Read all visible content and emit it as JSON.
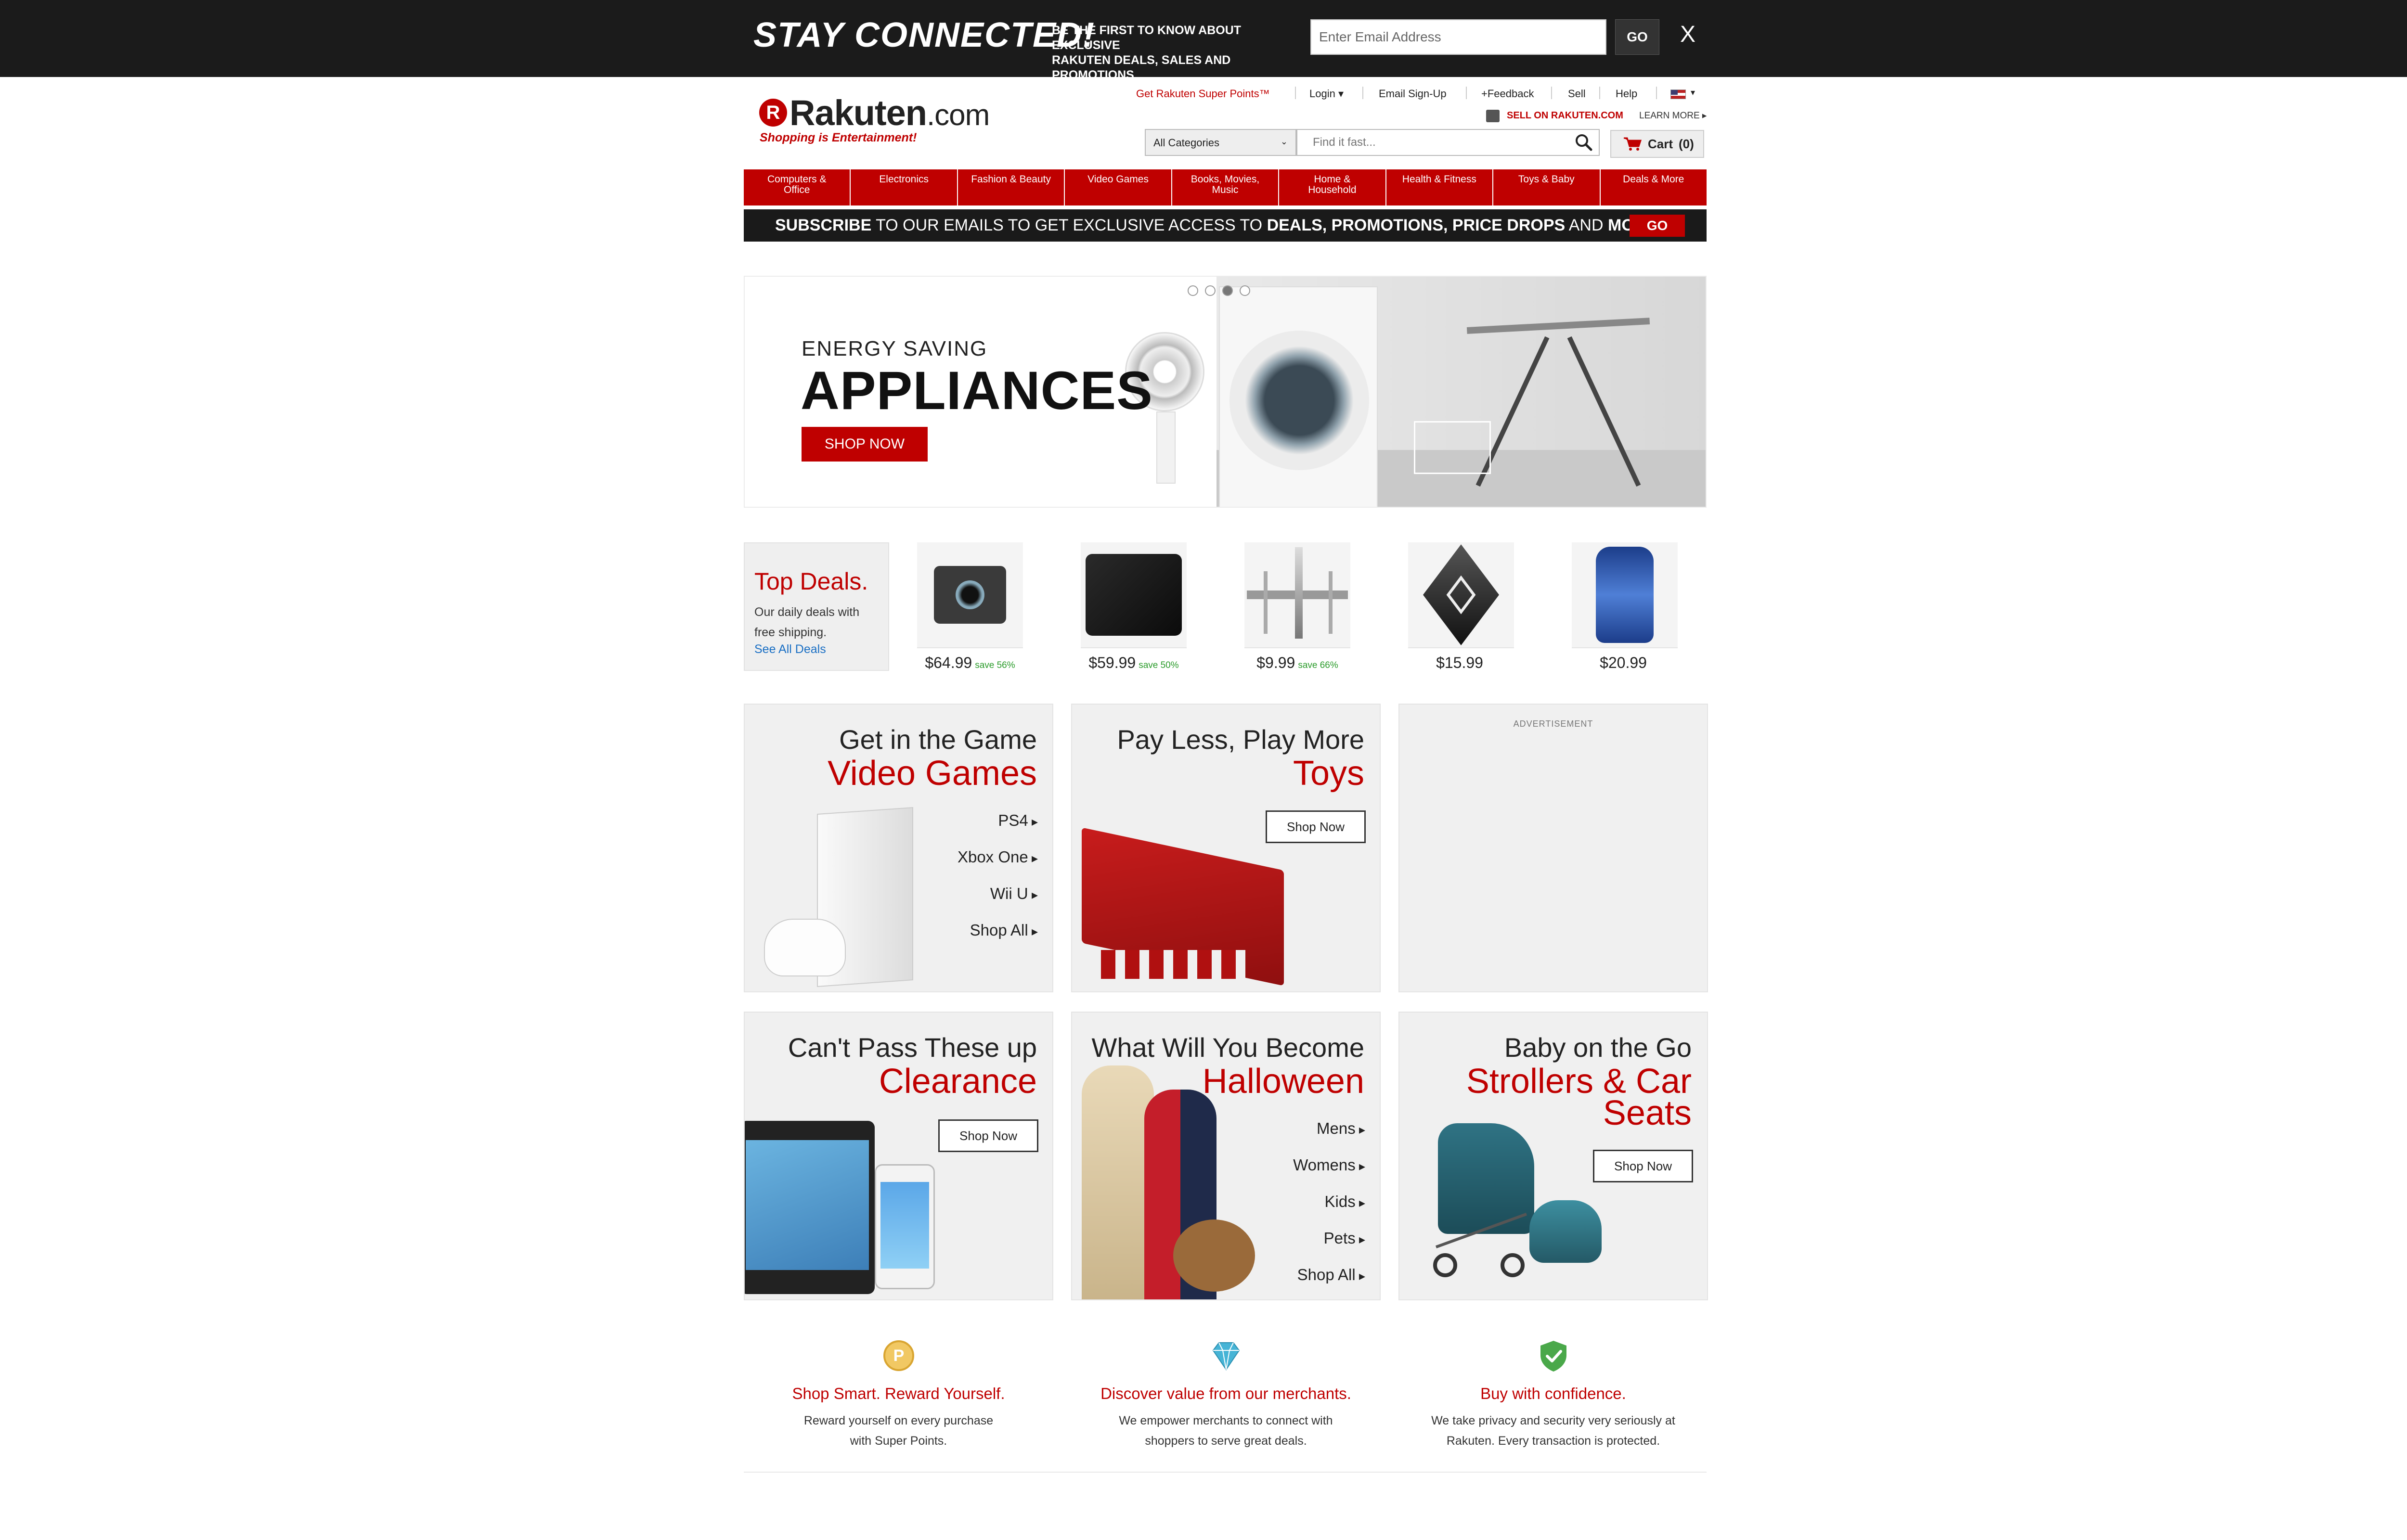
{
  "banner": {
    "title": "STAY CONNECTED!",
    "subtitle_line1": "BE THE FIRST TO KNOW ABOUT EXCLUSIVE",
    "subtitle_line2": "RAKUTEN DEALS, SALES AND PROMOTIONS",
    "email_placeholder": "Enter Email Address",
    "go_label": "GO",
    "close_label": "X"
  },
  "header": {
    "super_points": "Get Rakuten Super Points™",
    "login": "Login ▾",
    "email_signup": "Email Sign-Up",
    "feedback": "+Feedback",
    "sell": "Sell",
    "help": "Help",
    "flag": "▾",
    "logo_letter": "R",
    "logo_name": "Rakuten",
    "logo_com": ".com",
    "tagline": "Shopping is Entertainment!",
    "sell_on": "SELL ON RAKUTEN.COM",
    "learn_more": "LEARN MORE ▸",
    "category_select": "All Categories",
    "search_placeholder": "Find it fast...",
    "cart_label": "Cart",
    "cart_count": "(0)"
  },
  "nav": [
    {
      "label": "Computers &\nOffice"
    },
    {
      "label": "Electronics"
    },
    {
      "label": "Fashion & Beauty"
    },
    {
      "label": "Video Games"
    },
    {
      "label": "Books, Movies,\nMusic"
    },
    {
      "label": "Home &\nHousehold"
    },
    {
      "label": "Health & Fitness"
    },
    {
      "label": "Toys & Baby"
    },
    {
      "label": "Deals & More"
    }
  ],
  "subscribe": {
    "bold1": "SUBSCRIBE",
    "text1": " TO OUR EMAILS TO GET EXCLUSIVE ACCESS TO ",
    "bold2": "DEALS, PROMOTIONS, PRICE DROPS",
    "text2": " AND ",
    "bold3": "MORE!",
    "go_label": "GO"
  },
  "hero": {
    "kicker": "ENERGY SAVING",
    "title": "APPLIANCES",
    "button": "SHOP NOW"
  },
  "top_deals": {
    "title": "Top Deals.",
    "line1": "Our daily deals with",
    "line2": "free shipping.",
    "link": "See All Deals",
    "items": [
      {
        "price": "$64.99",
        "save": "save 56%",
        "icon": "action-camera"
      },
      {
        "price": "$59.99",
        "save": "save 50%",
        "icon": "hard-drive"
      },
      {
        "price": "$9.99",
        "save": "save 66%",
        "icon": "knife-holder"
      },
      {
        "price": "$15.99",
        "save": "",
        "icon": "cube-speaker"
      },
      {
        "price": "$20.99",
        "save": "",
        "icon": "hydration-backpack"
      }
    ]
  },
  "tiles": {
    "games": {
      "sub": "Get in the Game",
      "title": "Video Games",
      "links": [
        "PS4",
        "Xbox One",
        "Wii U",
        "Shop All"
      ]
    },
    "toys": {
      "sub": "Pay Less, Play More",
      "title": "Toys",
      "button": "Shop Now"
    },
    "ad": {
      "label": "ADVERTISEMENT"
    },
    "clearance": {
      "sub": "Can't Pass These up",
      "title": "Clearance",
      "button": "Shop Now"
    },
    "halloween": {
      "sub": "What Will You Become",
      "title": "Halloween",
      "links": [
        "Mens",
        "Womens",
        "Kids",
        "Pets",
        "Shop All"
      ]
    },
    "strollers": {
      "sub": "Baby on the Go",
      "title_line1": "Strollers & Car",
      "title_line2": "Seats",
      "button": "Shop Now"
    }
  },
  "features": [
    {
      "title": "Shop Smart. Reward Yourself.",
      "line1": "Reward yourself on every purchase",
      "line2": "with Super Points.",
      "icon": "points-coin-icon"
    },
    {
      "title": "Discover value from our merchants.",
      "line1": "We empower merchants to connect with",
      "line2": "shoppers to serve great deals.",
      "icon": "diamond-icon"
    },
    {
      "title": "Buy with confidence.",
      "line1": "We take privacy and security very seriously at",
      "line2": "Rakuten. Every transaction is protected.",
      "icon": "shield-check-icon"
    }
  ],
  "colors": {
    "brand": "#bf0000",
    "banner_bg": "#1b1b1b",
    "save_green": "#2a9b2a",
    "link_blue": "#1a6fc4"
  }
}
